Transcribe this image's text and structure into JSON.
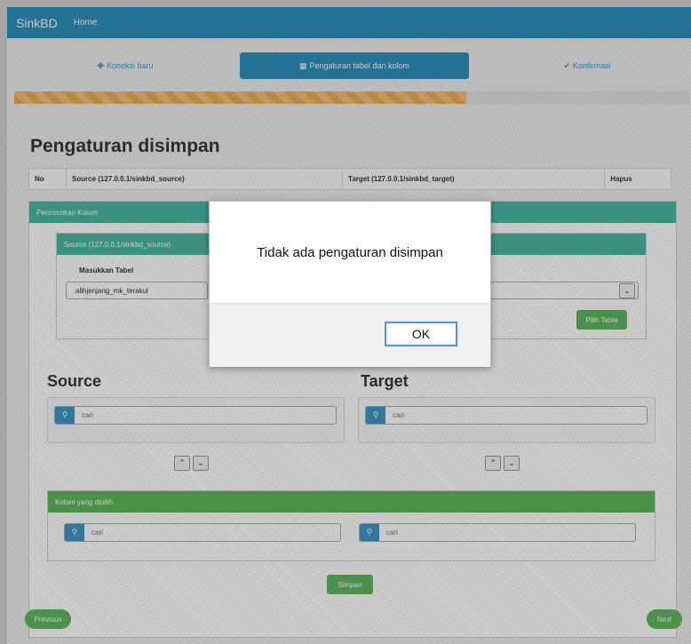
{
  "navbar": {
    "brand": "SinkBD",
    "home": "Home"
  },
  "wizard": {
    "steps": [
      {
        "label": "Koneksi baru",
        "icon": "plus-icon"
      },
      {
        "label": "Pengaturan tabel dan kolom",
        "icon": "table-icon"
      },
      {
        "label": "Konfirmasi",
        "icon": "check-icon"
      }
    ],
    "progress": 0.67
  },
  "saved": {
    "title": "Pengaturan disimpan",
    "columns": [
      "No",
      "Source (127.0.0.1/sinkbd_source)",
      "Target (127.0.0.1/sinkbd_target)",
      "Hapus"
    ]
  },
  "matching": {
    "heading": "Pencocokan Kolom",
    "source_panel_title": "Source (127.0.0.1/sinkbd_source)",
    "table_label": "Masukkan Tabel",
    "table_value": "allhjenjang_mk_terakul",
    "pick_table": "Pilih Table"
  },
  "source": {
    "title": "Source",
    "search_placeholder": "cari"
  },
  "target": {
    "title": "Target",
    "search_placeholder": "cari"
  },
  "selected": {
    "heading": "Kolom yang dipilih",
    "left_placeholder": "cari",
    "right_placeholder": "cari"
  },
  "buttons": {
    "save": "Simpan",
    "previous": "Previous",
    "next": "Next"
  },
  "dialog": {
    "message": "Tidak ada pengaturan disimpan",
    "ok": "OK"
  },
  "colors": {
    "navbar": "#2a8fbd",
    "green": "#5cb85c",
    "teal": "#45b8a0",
    "progress": "#f0ad4e"
  }
}
